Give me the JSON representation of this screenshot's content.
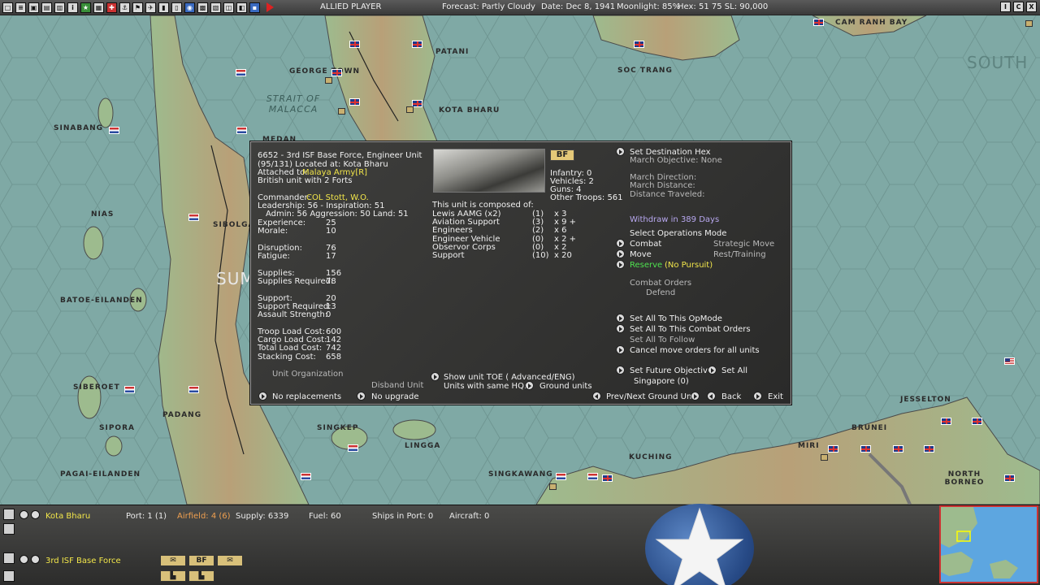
{
  "top_bar": {
    "side": "ALLIED PLAYER",
    "forecast": "Forecast: Partly Cloudy",
    "date": "Date: Dec 8, 1941",
    "moonlight": "Moonlight: 85%",
    "hex": "Hex: 51  75  SL: 90,000",
    "right_buttons": [
      "I",
      "C",
      "X"
    ]
  },
  "map": {
    "places": [
      "PATANI",
      "CAM RANH BAY",
      "GEORGE TOWN",
      "SOC TRANG",
      "KOTA BHARU",
      "SINABANG",
      "MEDAN",
      "NIAS",
      "SIBOLGA",
      "BATOE-EILANDEN",
      "SIBEROET",
      "PADANG",
      "SIPORA",
      "PAGAI-EILANDEN",
      "SINGKEP",
      "LINGGA",
      "SINGKAWANG",
      "KUCHING",
      "MIRI",
      "BRUNEI",
      "JESSELTON",
      "NORTH BORNEO"
    ],
    "seas": [
      "STRAIT OF MALACCA",
      "SOUTH",
      "SUM"
    ]
  },
  "dialog": {
    "header_lines": [
      "6652 - 3rd ISF Base Force, Engineer Unit",
      "(95/131) Located at: Kota Bharu"
    ],
    "attached_label": "Attached to:",
    "attached_value": "Malaya Army[R]",
    "british_note": "British unit with 2 Forts",
    "commander_label": "Commander:",
    "commander_value": "COL Stott, W.O.",
    "leadership": "Leadership: 56 - Inspiration: 51",
    "admin": "Admin: 56  Aggression: 50  Land: 51",
    "stats": [
      {
        "label": "Experience:",
        "value": "25"
      },
      {
        "label": "Morale:",
        "value": "10"
      },
      {
        "label": "Disruption:",
        "value": "76"
      },
      {
        "label": "Fatigue:",
        "value": "17"
      },
      {
        "label": "Supplies:",
        "value": "156"
      },
      {
        "label": "Supplies Required:",
        "value": "78"
      },
      {
        "label": "Support:",
        "value": "20"
      },
      {
        "label": "Support Required:",
        "value": "13"
      },
      {
        "label": "Assault Strength:",
        "value": "0"
      },
      {
        "label": "Troop Load Cost:",
        "value": "600"
      },
      {
        "label": "Cargo Load Cost:",
        "value": "142"
      },
      {
        "label": "Total Load Cost:",
        "value": "742"
      },
      {
        "label": "Stacking Cost:",
        "value": "658"
      }
    ],
    "unit_type_badge": "BF",
    "counts": [
      "Infantry: 0",
      "Vehicles: 2",
      "Guns: 4",
      "Other Troops: 561"
    ],
    "composition_title": "This unit is composed of:",
    "composition": [
      {
        "name": "Lewis AAMG (x2)",
        "qty": "(1)",
        "mult": "x 3"
      },
      {
        "name": "Aviation Support",
        "qty": "(3)",
        "mult": "x 9 +"
      },
      {
        "name": "Engineers",
        "qty": "(2)",
        "mult": "x 6"
      },
      {
        "name": "Engineer Vehicle",
        "qty": "(0)",
        "mult": "x 2 +"
      },
      {
        "name": "Observor Corps",
        "qty": "(0)",
        "mult": "x 2"
      },
      {
        "name": "Support",
        "qty": "(10)",
        "mult": "x 20"
      }
    ],
    "set_destination": "Set Destination Hex",
    "march_objective": "March Objective: None",
    "march_direction": "March Direction:",
    "march_distance": "March Distance:",
    "distance_traveled": "Distance Traveled:",
    "withdraw": "Withdraw in 389 Days",
    "ops_mode_title": "Select Operations Mode",
    "ops_combat": "Combat",
    "ops_strategic": "Strategic Move",
    "ops_move": "Move",
    "ops_rest": "Rest/Training",
    "ops_reserve": "Reserve",
    "ops_reserve_note": "(No Pursuit)",
    "combat_orders_title": "Combat Orders",
    "combat_orders_value": "Defend",
    "set_all_opmode": "Set All To This OpMode",
    "set_all_combat": "Set All To This Combat Orders",
    "set_all_follow": "Set All To Follow",
    "cancel_move": "Cancel move orders for all units",
    "set_future_objective": "Set Future Objective",
    "set_all": "Set All",
    "future_objective_value": "Singapore (0)",
    "unit_org": "Unit Organization",
    "disband": "Disband Unit",
    "no_replacements": "No replacements",
    "no_upgrade": "No upgrade",
    "show_toe": "Show unit TOE ( Advanced/ENG)",
    "same_hq_label": "Units with same HQ:",
    "ground_units": "Ground units",
    "prev_next": "Prev/Next Ground Unit",
    "back": "Back",
    "exit": "Exit"
  },
  "bottom_bar": {
    "location": "Kota Bharu",
    "port": "Port: 1 (1)",
    "airfield": "Airfield: 4 (6)",
    "supply": "Supply: 6339",
    "fuel": "Fuel: 60",
    "ships_in_port": "Ships in Port: 0",
    "aircraft": "Aircraft: 0",
    "unit_name": "3rd ISF Base Force",
    "counter_badge": "BF"
  }
}
